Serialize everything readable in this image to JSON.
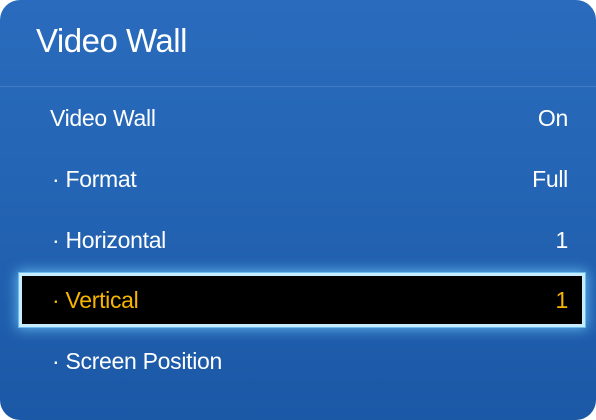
{
  "panel": {
    "title": "Video Wall"
  },
  "items": [
    {
      "label": "Video Wall",
      "value": "On"
    },
    {
      "label": "· Format",
      "value": "Full"
    },
    {
      "label": "· Horizontal",
      "value": "1"
    },
    {
      "label": "· Vertical",
      "value": "1",
      "selected": true
    },
    {
      "label": "· Screen Position",
      "value": ""
    }
  ],
  "colors": {
    "panel_background": "#2566b6",
    "text": "#ffffff",
    "selected_background": "#000000",
    "selected_text": "#f7b500",
    "selected_glow": "#82d7ff"
  }
}
